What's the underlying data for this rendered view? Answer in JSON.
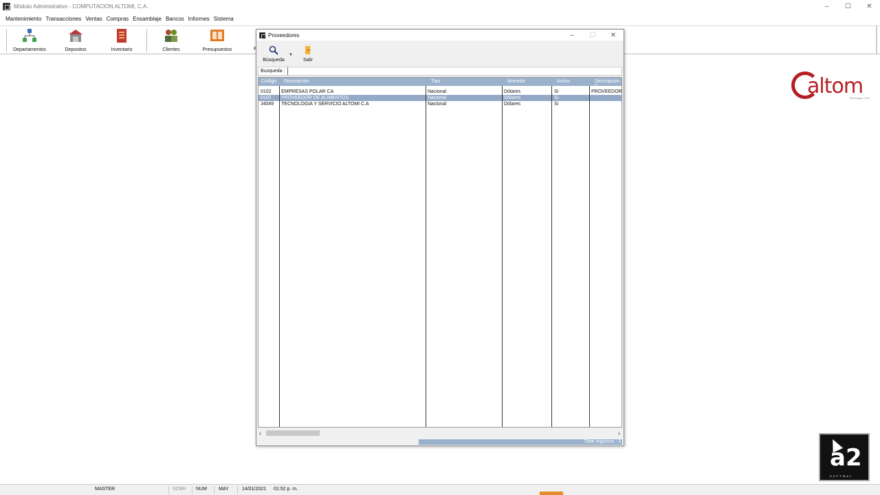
{
  "window": {
    "title": "Módulo Administrativo - COMPUTACION ALTOMI, C.A.",
    "controls": [
      "–",
      "☐",
      "✕"
    ]
  },
  "menu": [
    "Mantenimiento",
    "Transacciones",
    "Ventas",
    "Compras",
    "Ensamblaje",
    "Bancos",
    "Informes",
    "Sistema"
  ],
  "toolbar": {
    "items": [
      {
        "label": "Departamentos",
        "icon": "departments-icon"
      },
      {
        "label": "Depositos",
        "icon": "warehouse-icon"
      },
      {
        "label": "Inventario",
        "icon": "inventory-icon"
      },
      {
        "label": "Clientes",
        "icon": "clients-icon"
      },
      {
        "label": "Presupuestos",
        "icon": "budget-icon"
      }
    ],
    "partial_label": "F"
  },
  "logo": {
    "text": "altom",
    "tagline": "Tecnología X Ser"
  },
  "dialog": {
    "title": "Proveedores",
    "controls": [
      "–",
      "☐",
      "✕"
    ],
    "tools": {
      "search_label": "Búsqueda",
      "exit_label": "Salir"
    },
    "search": {
      "label": "Busqueda :",
      "value": ""
    },
    "columns": [
      "Código",
      "Descripción",
      "Tipo",
      "Moneda",
      "Activo",
      "Descripción C"
    ],
    "rows": [
      {
        "codigo": "0102",
        "descripcion": "EMPRESAS POLAR CA",
        "tipo": "Nacional",
        "moneda": "Dólares",
        "activo": "Si",
        "desc2": "PROVEEDOR",
        "selected": false
      },
      {
        "codigo": "0102",
        "descripcion": "PROVEEDOR DE ALIMENTOS",
        "tipo": "Nacional",
        "moneda": "Dólares",
        "activo": "Si",
        "desc2": "",
        "selected": true
      },
      {
        "codigo": "J4049",
        "descripcion": "TECNOLOGIA Y SERVICIO ALTOMI C.A",
        "tipo": "Nacional",
        "moneda": "Dólares",
        "activo": "Si",
        "desc2": "",
        "selected": false
      }
    ],
    "status": "Total registros : 3"
  },
  "statusbar": {
    "user": "MASTER",
    "sobr": "SOBR",
    "num": "NUM",
    "may": "MAY",
    "date": "14/01/2021",
    "time": "01:52 p. m."
  },
  "a2": {
    "text": "a2",
    "sub": "SOFTWAY"
  },
  "colors": {
    "grid_header": "#9ab1cc",
    "selected_row": "#93a9c6",
    "logo_red": "#b41f24"
  }
}
